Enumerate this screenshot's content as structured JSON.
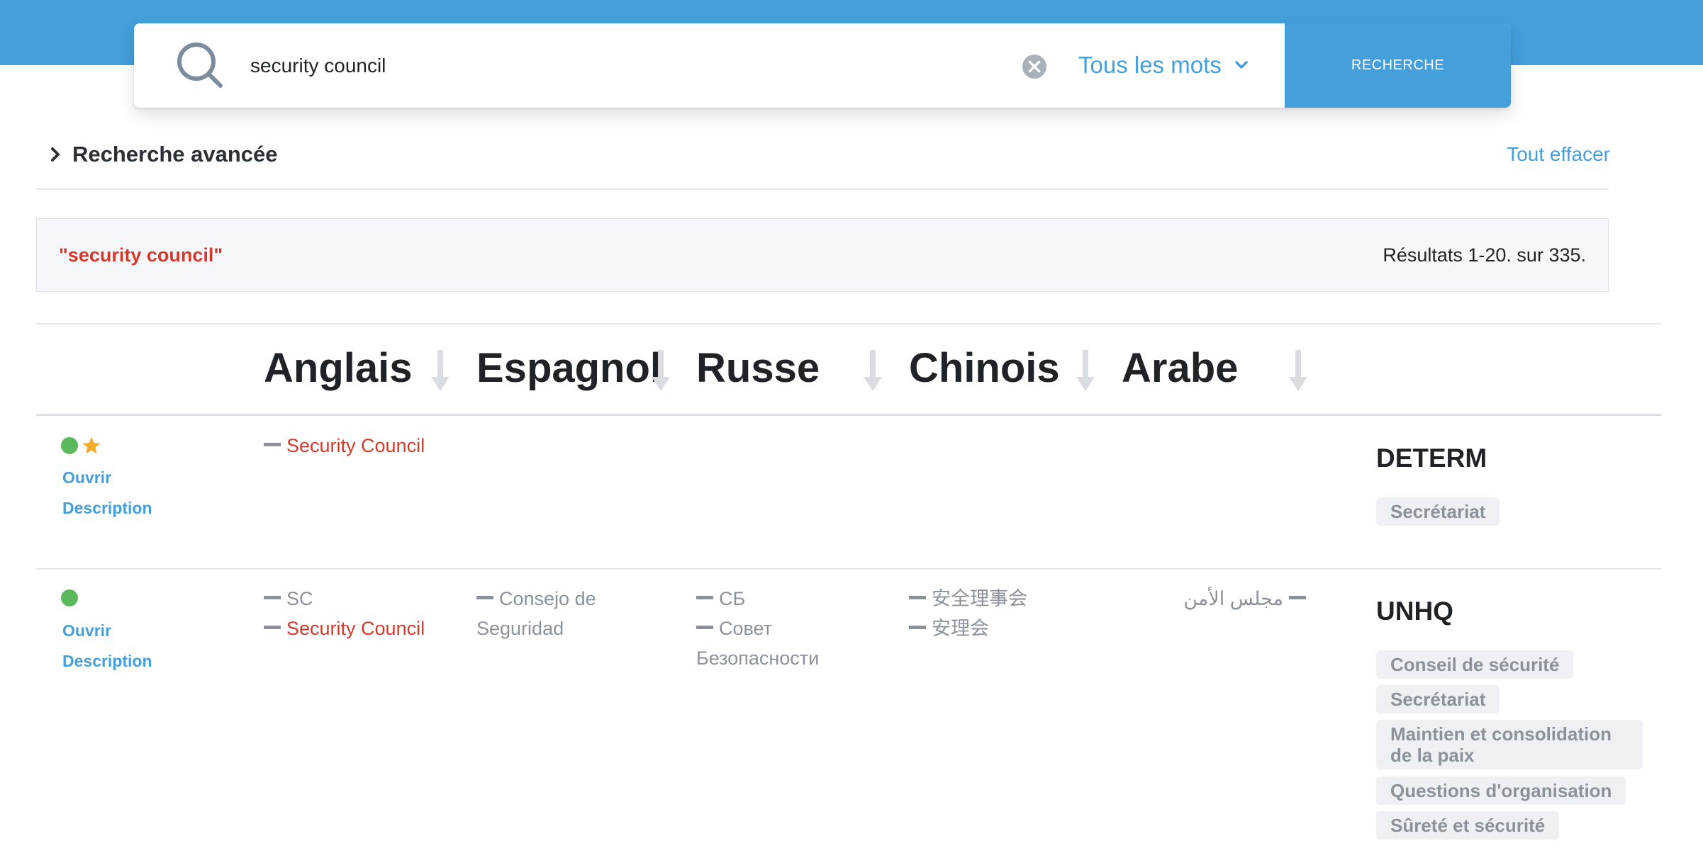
{
  "search": {
    "query": "security council",
    "placeholder": "",
    "mode": "Tous les mots",
    "button_label": "RECHERCHE"
  },
  "advanced": {
    "label": "Recherche avancée",
    "clear_all": "Tout effacer"
  },
  "summary": {
    "query_label": "\"security council\"",
    "results_text": "Résultats 1-20. sur 335."
  },
  "columns": [
    "Anglais",
    "Espagnol",
    "Russe",
    "Chinois",
    "Arabe"
  ],
  "row_links": {
    "open": "Ouvrir",
    "description": "Description"
  },
  "rows": [
    {
      "starred": true,
      "english": [
        "Security Council"
      ],
      "source": "DETERM",
      "tags": [
        "Secrétariat"
      ]
    },
    {
      "starred": false,
      "english": [
        "SC",
        "Security Council"
      ],
      "spanish": [
        "Consejo de",
        "Seguridad"
      ],
      "russian": [
        "СБ",
        "Совет",
        "Безопасности"
      ],
      "chinese": [
        "安全理事会",
        "安理会"
      ],
      "arabic": [
        "مجلس الأمن"
      ],
      "source": "UNHQ",
      "tags": [
        "Conseil de sécurité",
        "Secrétariat",
        "Maintien et consolidation",
        "de la paix",
        "Questions d'organisation",
        "Sûreté et sécurité"
      ]
    }
  ],
  "colors": {
    "accent": "#449fdb",
    "highlight": "#d33a2c",
    "status_green": "#5cb85c",
    "star": "#f0ad2e",
    "muted": "#8a929c"
  },
  "icons": [
    "search-icon",
    "clear-icon",
    "chevron-down-icon",
    "chevron-right-icon",
    "sort-arrow-icon",
    "star-icon"
  ]
}
